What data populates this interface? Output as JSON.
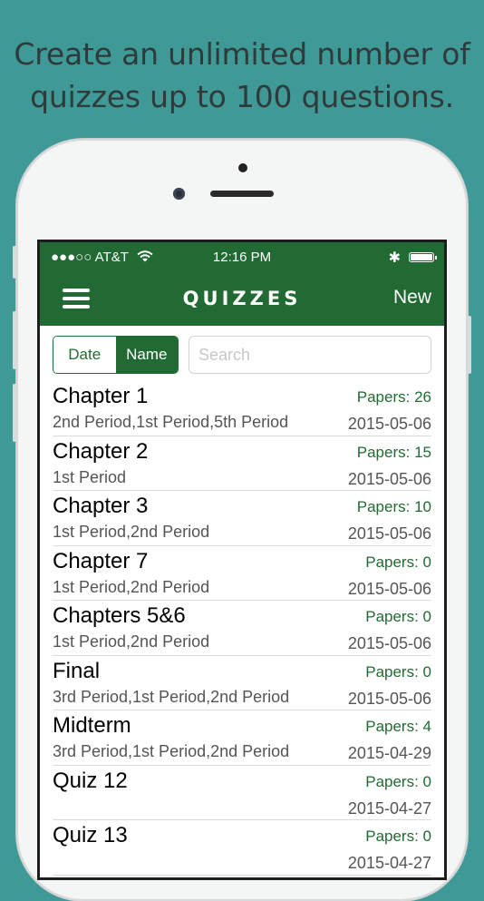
{
  "caption": {
    "line1": "Create an unlimited number of",
    "line2": "quizzes up to 100 questions."
  },
  "status_bar": {
    "carrier": "●●●○○ AT&T",
    "wifi_icon": "wifi-icon",
    "time": "12:16 PM",
    "bluetooth": "✱",
    "battery_icon": "battery-icon"
  },
  "nav": {
    "menu_icon": "hamburger-menu-icon",
    "title": "QUIZZES",
    "new_label": "New"
  },
  "sort": {
    "options": [
      "Date",
      "Name"
    ],
    "selected": "Name"
  },
  "search": {
    "placeholder": "Search",
    "value": ""
  },
  "colors": {
    "background": "#3f9a97",
    "brand_green": "#226a34"
  },
  "quizzes": [
    {
      "name": "Chapter 1",
      "periods": "2nd Period,1st Period,5th Period",
      "papers": "Papers: 26",
      "date": "2015-05-06"
    },
    {
      "name": "Chapter 2",
      "periods": "1st Period",
      "papers": "Papers: 15",
      "date": "2015-05-06"
    },
    {
      "name": "Chapter 3",
      "periods": "1st Period,2nd Period",
      "papers": "Papers: 10",
      "date": "2015-05-06"
    },
    {
      "name": "Chapter 7",
      "periods": "1st Period,2nd Period",
      "papers": "Papers: 0",
      "date": "2015-05-06"
    },
    {
      "name": "Chapters 5&6",
      "periods": "1st Period,2nd Period",
      "papers": "Papers: 0",
      "date": "2015-05-06"
    },
    {
      "name": "Final",
      "periods": "3rd Period,1st Period,2nd Period",
      "papers": "Papers: 0",
      "date": "2015-05-06"
    },
    {
      "name": "Midterm",
      "periods": "3rd Period,1st Period,2nd Period",
      "papers": "Papers: 4",
      "date": "2015-04-29"
    },
    {
      "name": "Quiz 12",
      "periods": "",
      "papers": "Papers: 0",
      "date": "2015-04-27"
    },
    {
      "name": "Quiz 13",
      "periods": "",
      "papers": "Papers: 0",
      "date": "2015-04-27"
    }
  ]
}
